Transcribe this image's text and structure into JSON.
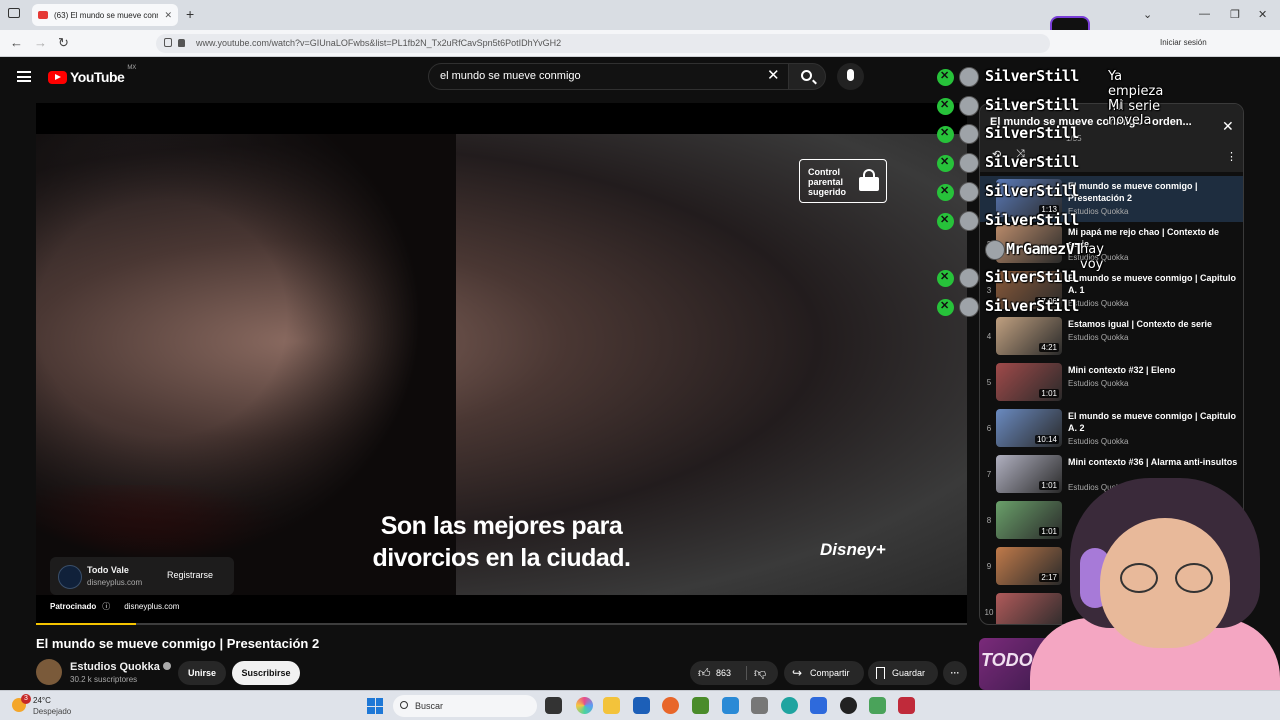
{
  "browser": {
    "tab_title": "(63) El mundo se mueve conmi",
    "url": "www.youtube.com/watch?v=GIUnaLOFwbs&list=PL1fb2N_Tx2uRfCavSpn5t6PotIDhYvGH2",
    "signin": "Iniciar sesión",
    "new_tab": "+",
    "back": "←",
    "forward": "→",
    "reload": "↻"
  },
  "header": {
    "logo": "YouTube",
    "country": "MX",
    "search_value": "el mundo se mueve conmigo"
  },
  "player": {
    "subtitle_line1": "Son las mejores para",
    "subtitle_line2": "divorcios en la ciudad.",
    "parental_label": "Control parental sugerido",
    "brand": "Disney+",
    "ad": {
      "name": "Todo Vale",
      "domain": "disneyplus.com",
      "cta": "Registrarse",
      "sponsored": "Patrocinado",
      "sponsored_domain": "disneyplus.com"
    },
    "progress": 0.107,
    "accent": "#f5c400"
  },
  "video": {
    "title": "El mundo se mueve conmigo | Presentación 2",
    "channel": "Estudios Quokka",
    "subscribers": "30.2 k suscriptores",
    "join": "Unirse",
    "subscribe": "Suscribirse",
    "likes": "863",
    "share": "Compartir",
    "save": "Guardar"
  },
  "playlist": {
    "title": "El mundo se mueve conmigo - orden...",
    "position": "1/55",
    "items": [
      {
        "idx": "",
        "title": "El mundo se mueve conmigo | Presentación 2",
        "channel": "Estudios Quokka",
        "duration": "1:13",
        "active": true
      },
      {
        "idx": "2",
        "title": "Mi papá me rejo chao | Contexto de serie",
        "channel": "Estudios Quokka",
        "duration": "",
        "active": false
      },
      {
        "idx": "3",
        "title": "El mundo se mueve conmigo | Capitulo A. 1",
        "channel": "Estudios Quokka",
        "duration": "17:06",
        "active": false
      },
      {
        "idx": "4",
        "title": "Estamos igual | Contexto de serie",
        "channel": "Estudios Quokka",
        "duration": "4:21",
        "active": false
      },
      {
        "idx": "5",
        "title": "Mini contexto #32 | Eleno",
        "channel": "Estudios Quokka",
        "duration": "1:01",
        "active": false
      },
      {
        "idx": "6",
        "title": "El mundo se mueve conmigo | Capitulo A. 2",
        "channel": "Estudios Quokka",
        "duration": "10:14",
        "active": false
      },
      {
        "idx": "7",
        "title": "Mini contexto #36 | Alarma anti-insultos",
        "channel": "Estudios Quokka",
        "duration": "1:01",
        "active": false
      },
      {
        "idx": "8",
        "title": "",
        "channel": "",
        "duration": "1:01",
        "active": false
      },
      {
        "idx": "9",
        "title": "",
        "channel": "",
        "duration": "2:17",
        "active": false
      },
      {
        "idx": "10",
        "title": "",
        "channel": "",
        "duration": "",
        "active": false
      }
    ]
  },
  "chat": [
    {
      "name": "SilverStill",
      "message": "Ya empieza mi serie"
    },
    {
      "name": "SilverStill",
      "message": "Mi novela"
    },
    {
      "name": "SilverStill",
      "message": ""
    },
    {
      "name": "SilverStill",
      "message": ""
    },
    {
      "name": "SilverStill",
      "message": ""
    },
    {
      "name": "SilverStill",
      "message": ""
    },
    {
      "name": "MrGamezVT",
      "message": "hay voy"
    },
    {
      "name": "SilverStill",
      "message": ""
    },
    {
      "name": "SilverStill",
      "message": ""
    }
  ],
  "overlay": {
    "hulu_text": "TODO"
  },
  "taskbar": {
    "temperature": "24°C",
    "condition": "Despejado",
    "badge": "3",
    "search": "Buscar"
  }
}
